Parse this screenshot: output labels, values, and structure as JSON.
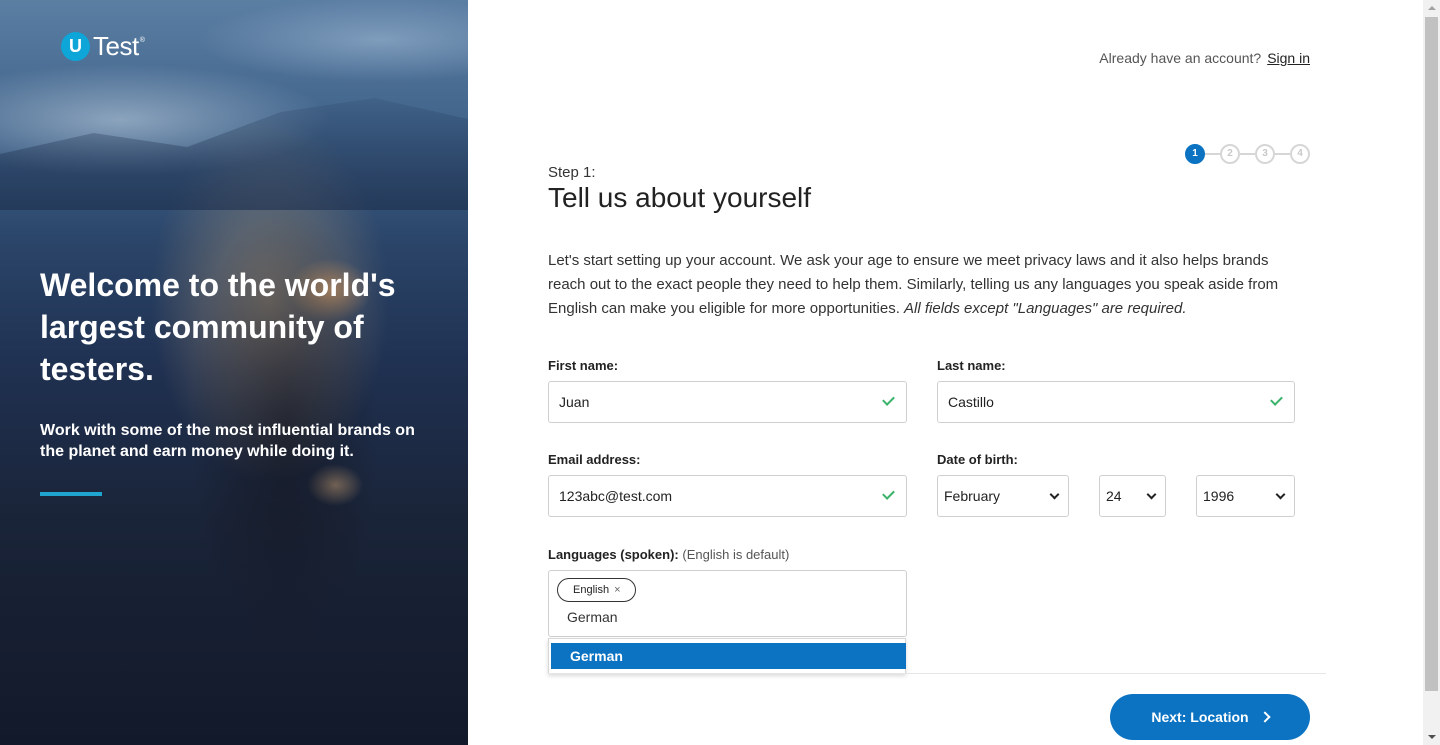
{
  "hero": {
    "logo_letter": "U",
    "logo_text": "Test",
    "logo_tm": "®",
    "title": "Welcome to the world's largest community of testers.",
    "subtitle": "Work with some of the most influential brands on the planet and earn money while doing it."
  },
  "header": {
    "signin_prompt": "Already have an account?",
    "signin_link": "Sign in"
  },
  "stepper": {
    "steps": [
      "1",
      "2",
      "3",
      "4"
    ],
    "active_step": 1
  },
  "form": {
    "step_label": "Step 1:",
    "title": "Tell us about yourself",
    "intro": "Let's start setting up your account. We ask your age to ensure we meet privacy laws and it also helps brands reach out to the exact people they need to help them. Similarly, telling us any languages you speak aside from English can make you eligible for more opportunities.",
    "intro_note": "All fields except \"Languages\" are required.",
    "first_name": {
      "label": "First name:",
      "value": "Juan"
    },
    "last_name": {
      "label": "Last name:",
      "value": "Castillo"
    },
    "email": {
      "label": "Email address:",
      "value": "123abc@test.com"
    },
    "dob": {
      "label": "Date of birth:",
      "month": "February",
      "day": "24",
      "year": "1996"
    },
    "languages": {
      "label": "Languages (spoken):",
      "hint": "(English is default)",
      "chips": [
        "English"
      ],
      "typed": "German",
      "suggestions": [
        "German"
      ]
    },
    "next_button": "Next: Location"
  },
  "colors": {
    "accent": "#0b73c2",
    "logo_badge": "#0ea5d8",
    "valid_check": "#3bb36b",
    "hero_bar": "#1fa5d0"
  }
}
